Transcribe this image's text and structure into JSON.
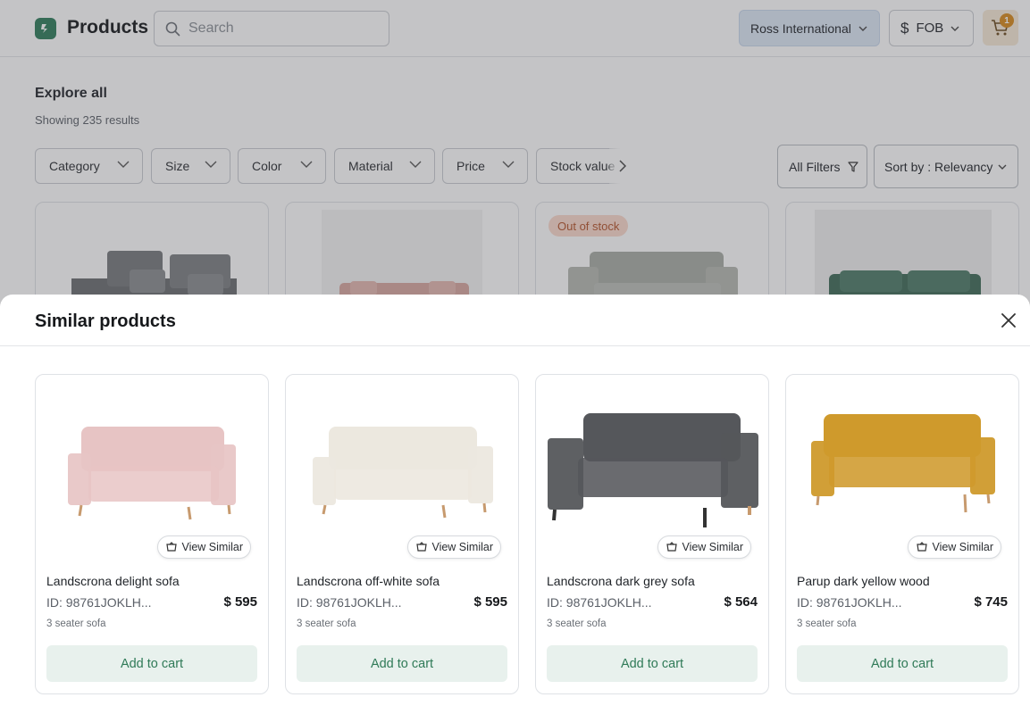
{
  "header": {
    "title": "Products",
    "search_placeholder": "Search",
    "organization": "Ross International",
    "currency_symbol": "$",
    "incoterm": "FOB",
    "cart_count": "1"
  },
  "explore": {
    "title": "Explore all",
    "results_text": "Showing 235 results",
    "filters": [
      "Category",
      "Size",
      "Color",
      "Material",
      "Price",
      "Stock value"
    ],
    "all_filters_label": "All Filters",
    "sort_label": "Sort by : Relevancy",
    "out_of_stock_label": "Out of stock"
  },
  "similar": {
    "title": "Similar products",
    "view_similar_label": "View Similar",
    "add_to_cart_label": "Add to cart",
    "products": [
      {
        "name": "Landscrona delight sofa",
        "id": "ID: 98761JOKLH...",
        "price": "$ 595",
        "type": "3 seater sofa",
        "color": "#e7c4c4"
      },
      {
        "name": "Landscrona off-white sofa",
        "id": "ID: 98761JOKLH...",
        "price": "$ 595",
        "type": "3 seater sofa",
        "color": "#ece8df"
      },
      {
        "name": "Landscrona dark grey sofa",
        "id": "ID: 98761JOKLH...",
        "price": "$ 564",
        "type": "3 seater sofa",
        "color": "#55575b"
      },
      {
        "name": "Parup dark yellow wood",
        "id": "ID: 98761JOKLH...",
        "price": "$ 745",
        "type": "3 seater sofa",
        "color": "#cf9a2c"
      }
    ]
  },
  "colors": {
    "brand": "#2e7d5b",
    "accent_blue": "#dce7f5",
    "cart_badge": "#d88a1b",
    "button_bg": "#e8f1ed",
    "button_text": "#2f7a57"
  }
}
